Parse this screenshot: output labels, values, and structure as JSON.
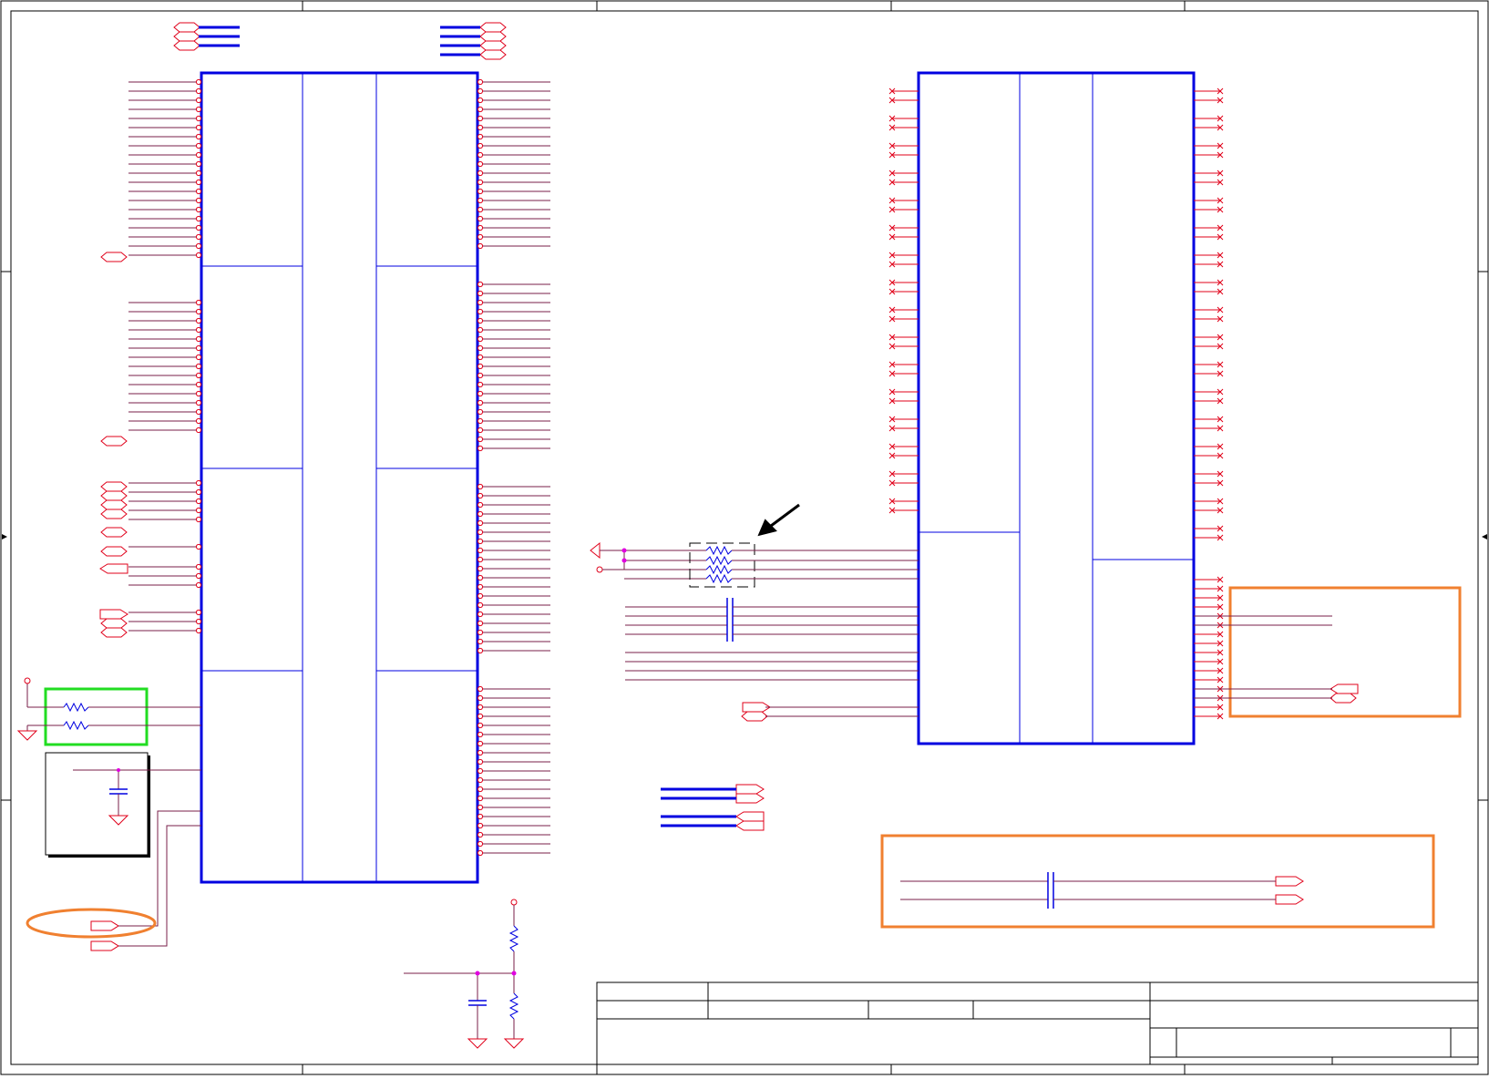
{
  "sheet": {
    "title_block": {
      "rows": 4
    }
  },
  "colors": {
    "wire": "#e0001a",
    "net": "#7a1f4a",
    "component": "#0000e0",
    "frame": "#000000",
    "highlight_green": "#22dd22",
    "highlight_orange": "#f08030",
    "junction": "#e000e0"
  },
  "components": {
    "left_ic": {
      "units": 8
    },
    "right_ic": {
      "units": 5
    },
    "resistor_network": {
      "elements": 4
    },
    "callout_arrow": {
      "direction": "down-left"
    }
  }
}
